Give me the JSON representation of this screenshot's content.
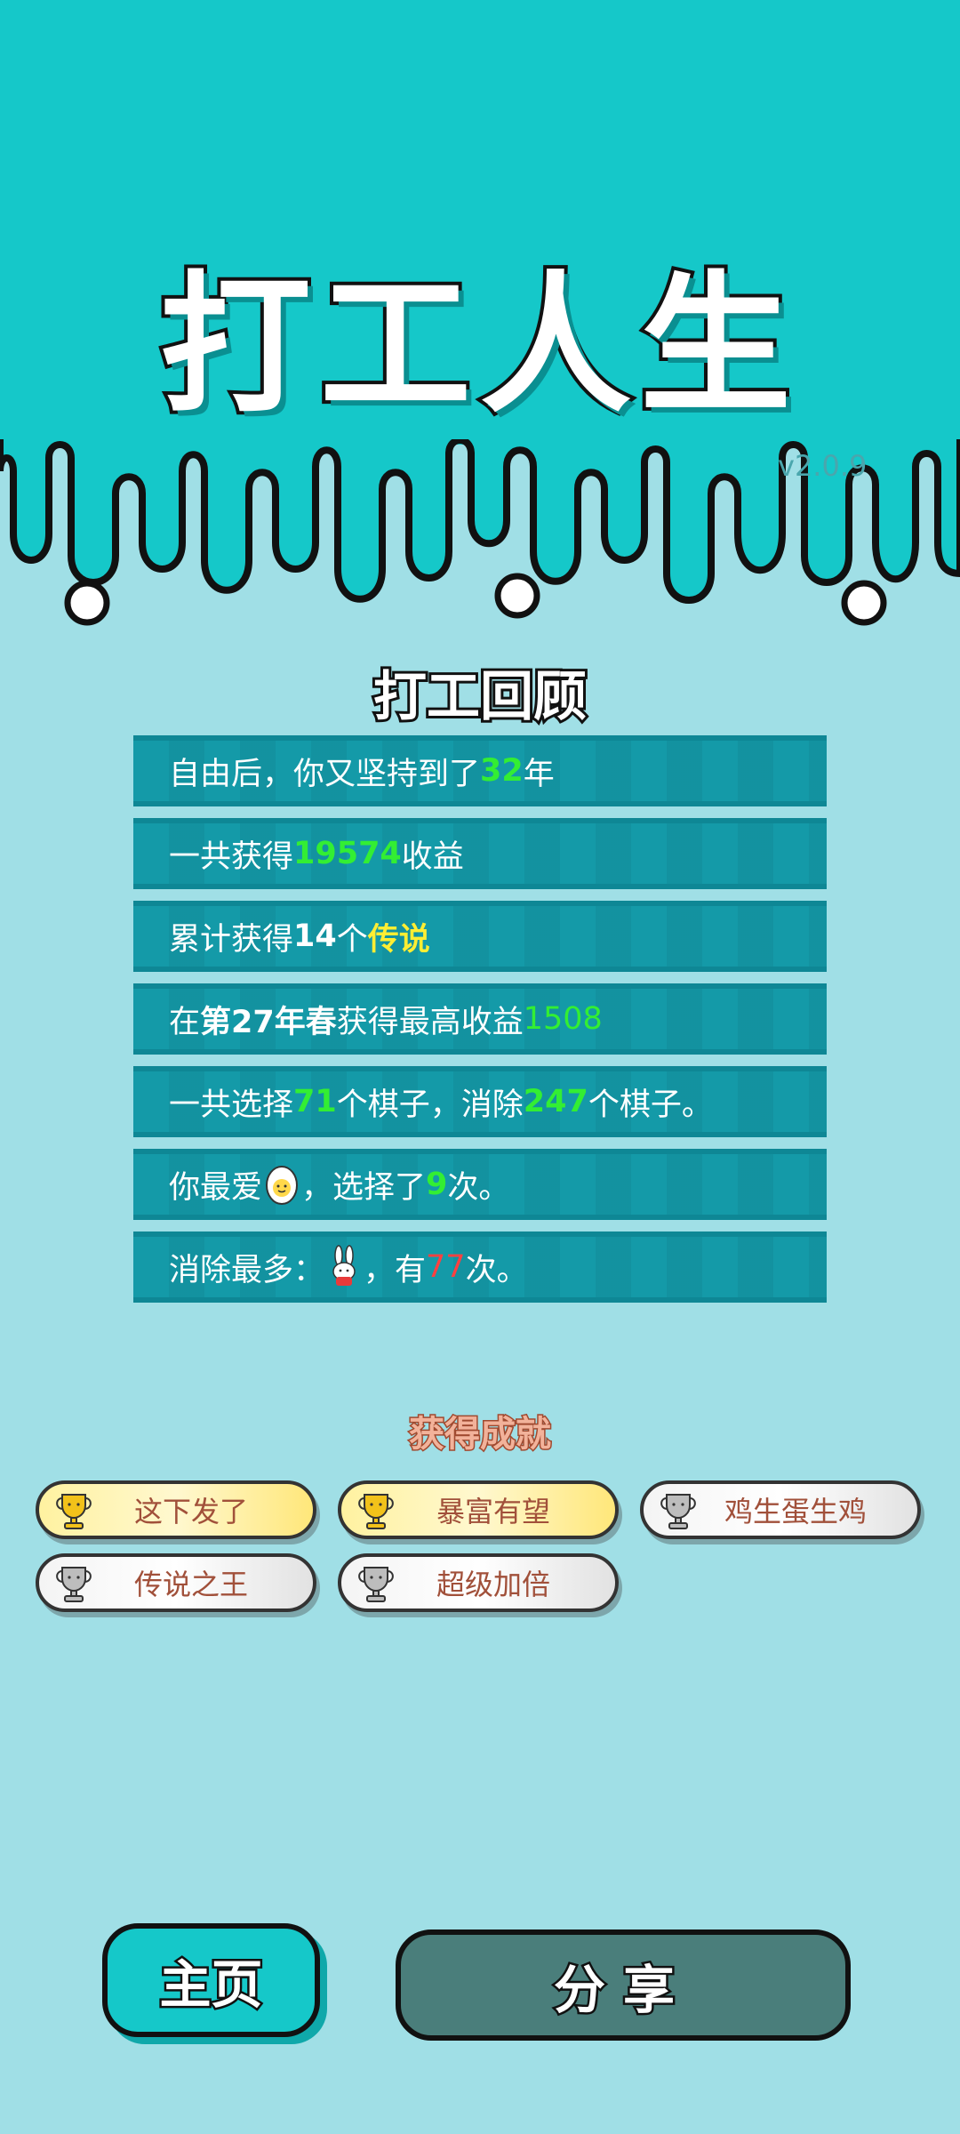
{
  "game_title": "打工人生",
  "version": "v2.0.9",
  "review_title": "打工回顾",
  "stats": {
    "row1": {
      "pre": "自由后，你又坚持到了",
      "years": "32",
      "post": "年"
    },
    "row2": {
      "pre": "一共获得",
      "income": "19574",
      "post": "收益"
    },
    "row3": {
      "pre": "累计获得",
      "count": "14",
      "mid": "个",
      "legend": "传说"
    },
    "row4": {
      "pre": "在 ",
      "season": "第27年春",
      "mid": " 获得最高收益",
      "max_income": "1508"
    },
    "row5": {
      "pre": "一共选择",
      "chosen": "71",
      "mid": "个棋子，消除",
      "removed": "247",
      "post": "个棋子。"
    },
    "row6": {
      "pre": "你最爱",
      "icon": "egg-icon",
      "mid": "，选择了",
      "times": "9",
      "post": "次。"
    },
    "row7": {
      "pre": "消除最多：",
      "icon": "rabbit-icon",
      "mid": "，有",
      "times": "77",
      "post": "次。"
    }
  },
  "achievements_title": "获得成就",
  "achievements": [
    {
      "label": "这下发了",
      "tier": "gold"
    },
    {
      "label": "暴富有望",
      "tier": "gold"
    },
    {
      "label": "鸡生蛋生鸡",
      "tier": "silver"
    },
    {
      "label": "传说之王",
      "tier": "silver"
    },
    {
      "label": "超级加倍",
      "tier": "silver"
    }
  ],
  "buttons": {
    "home": "主页",
    "share": "分享"
  },
  "colors": {
    "teal": "#15c8c9",
    "background": "#a0dfe6",
    "row": "#149aa8",
    "highlight_green": "#33ee33",
    "highlight_yellow": "#ffee33",
    "highlight_red": "#ff4040"
  }
}
